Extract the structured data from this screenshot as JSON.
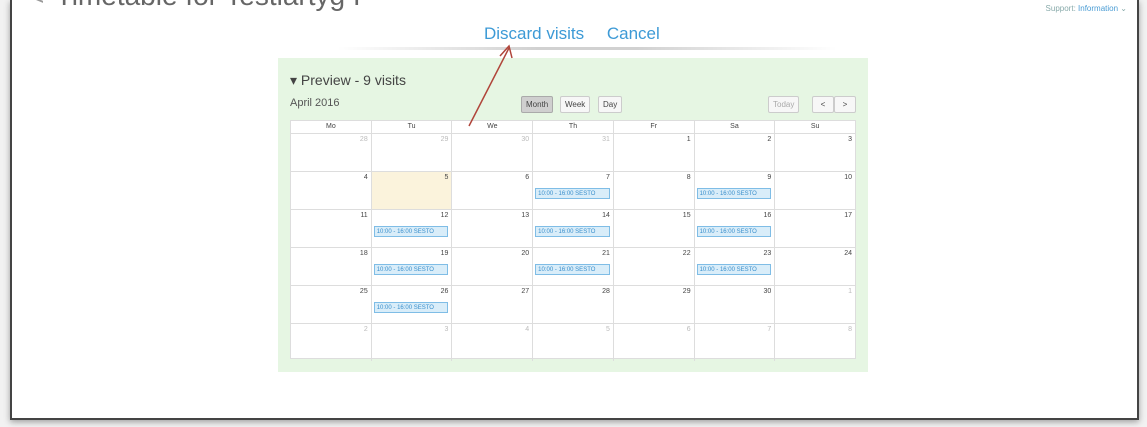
{
  "page": {
    "back_glyph": "<",
    "title": "Timetable for Testiartyg I",
    "support_label": "Support:",
    "support_link": "Information"
  },
  "actions": {
    "discard_label": "Discard visits",
    "cancel_label": "Cancel"
  },
  "preview": {
    "title": "▾ Preview - 9 visits",
    "month_label": "April 2016",
    "view_buttons": [
      "Month",
      "Week",
      "Day"
    ],
    "active_view": "Month",
    "today_label": "Today",
    "prev_label": "<",
    "next_label": ">"
  },
  "calendar": {
    "day_names": [
      "Mo",
      "Tu",
      "We",
      "Th",
      "Fr",
      "Sa",
      "Su"
    ],
    "weeks": [
      [
        {
          "d": "28",
          "o": true
        },
        {
          "d": "29",
          "o": true
        },
        {
          "d": "30",
          "o": true
        },
        {
          "d": "31",
          "o": true
        },
        {
          "d": "1"
        },
        {
          "d": "2"
        },
        {
          "d": "3"
        }
      ],
      [
        {
          "d": "4"
        },
        {
          "d": "5",
          "today": true
        },
        {
          "d": "6"
        },
        {
          "d": "7",
          "ev": "10:00 - 16:00 SESTO"
        },
        {
          "d": "8"
        },
        {
          "d": "9",
          "ev": "10:00 - 16:00 SESTO"
        },
        {
          "d": "10"
        }
      ],
      [
        {
          "d": "11"
        },
        {
          "d": "12",
          "ev": "10:00 - 16:00 SESTO"
        },
        {
          "d": "13"
        },
        {
          "d": "14",
          "ev": "10:00 - 16:00 SESTO"
        },
        {
          "d": "15"
        },
        {
          "d": "16",
          "ev": "10:00 - 16:00 SESTO"
        },
        {
          "d": "17"
        }
      ],
      [
        {
          "d": "18"
        },
        {
          "d": "19",
          "ev": "10:00 - 16:00 SESTO"
        },
        {
          "d": "20"
        },
        {
          "d": "21",
          "ev": "10:00 - 16:00 SESTO"
        },
        {
          "d": "22"
        },
        {
          "d": "23",
          "ev": "10:00 - 16:00 SESTO"
        },
        {
          "d": "24"
        }
      ],
      [
        {
          "d": "25"
        },
        {
          "d": "26",
          "ev": "10:00 - 16:00 SESTO"
        },
        {
          "d": "27"
        },
        {
          "d": "28"
        },
        {
          "d": "29"
        },
        {
          "d": "30"
        },
        {
          "d": "1",
          "o": true
        }
      ],
      [
        {
          "d": "2",
          "o": true
        },
        {
          "d": "3",
          "o": true
        },
        {
          "d": "4",
          "o": true
        },
        {
          "d": "5",
          "o": true
        },
        {
          "d": "6",
          "o": true
        },
        {
          "d": "7",
          "o": true
        },
        {
          "d": "8",
          "o": true
        }
      ]
    ]
  },
  "colors": {
    "accent": "#3d9ad6",
    "panel_bg": "#e6f6e3",
    "event_bg": "#d9edf9",
    "annotation_arrow": "#b0453a"
  }
}
